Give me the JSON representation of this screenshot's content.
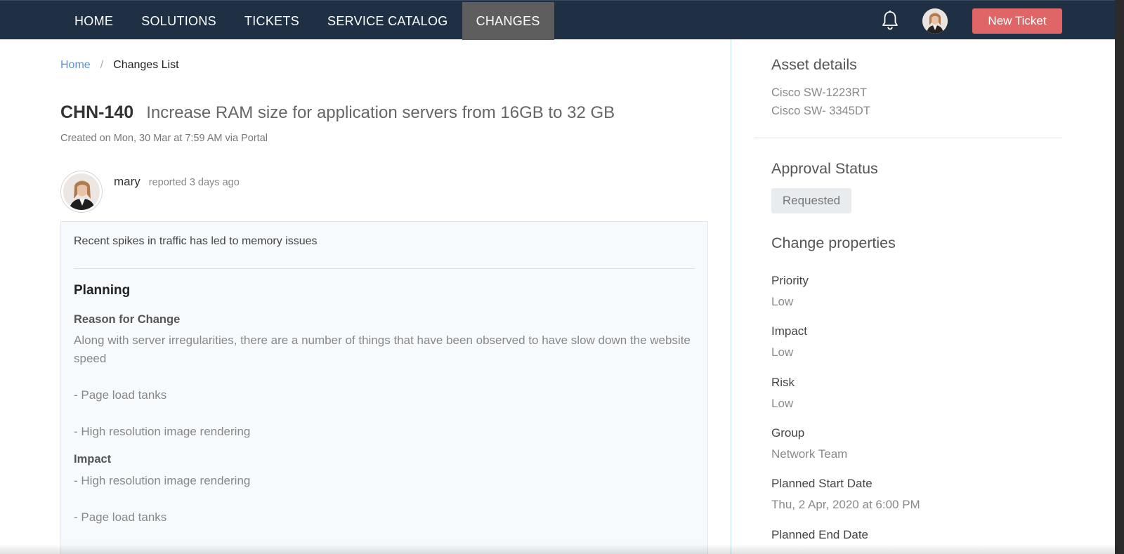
{
  "nav": {
    "items": [
      {
        "label": "HOME",
        "active": false
      },
      {
        "label": "SOLUTIONS",
        "active": false
      },
      {
        "label": "TICKETS",
        "active": false
      },
      {
        "label": "SERVICE CATALOG",
        "active": false
      },
      {
        "label": "CHANGES",
        "active": true
      }
    ],
    "new_ticket_label": "New Ticket",
    "icons": {
      "notifications": "bell-icon",
      "profile": "user-avatar"
    },
    "accent_color": "#e06566",
    "bar_color": "#1f2f44"
  },
  "breadcrumb": {
    "home": "Home",
    "separator": "/",
    "current": "Changes List"
  },
  "change": {
    "id": "CHN-140",
    "subject": "Increase RAM size for application servers from 16GB to 32 GB",
    "created": "Created on Mon, 30 Mar at 7:59 AM via Portal",
    "author": "mary",
    "reported": "reported 3 days ago",
    "summary": "Recent spikes in traffic has led to memory issues",
    "planning_title": "Planning",
    "reason_title": "Reason for Change",
    "reason_text": "Along with server irregularities, there are a number of things that have been observed to have slow down the website speed",
    "reason_bullet_1": "- Page load tanks",
    "reason_bullet_2": "- High resolution image rendering",
    "impact_title": "Impact",
    "impact_bullet_1": "- High resolution image rendering",
    "impact_bullet_2": "- Page load tanks"
  },
  "sidebar": {
    "asset_heading": "Asset details",
    "assets": [
      "Cisco SW-1223RT",
      "Cisco SW- 3345DT"
    ],
    "approval_heading": "Approval Status",
    "approval_status": "Requested",
    "properties_heading": "Change properties",
    "properties": [
      {
        "label": "Priority",
        "value": "Low"
      },
      {
        "label": "Impact",
        "value": "Low"
      },
      {
        "label": "Risk",
        "value": "Low"
      },
      {
        "label": "Group",
        "value": "Network Team"
      },
      {
        "label": "Planned Start Date",
        "value": "Thu, 2 Apr, 2020 at 6:00 PM"
      },
      {
        "label": "Planned End Date",
        "value": ""
      }
    ]
  }
}
